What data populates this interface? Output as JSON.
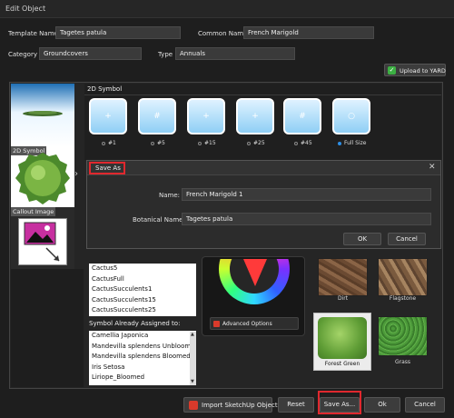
{
  "window": {
    "title": "Edit Object"
  },
  "form": {
    "template_name_label": "Template Name",
    "template_name_value": "Tagetes patula",
    "common_name_label": "Common Name",
    "common_name_value": "French Marigold",
    "category_label": "Category",
    "category_value": "Groundcovers",
    "type_label": "Type",
    "type_value": "Annuals"
  },
  "upload": {
    "label": "Upload to YARD",
    "checked": true
  },
  "left_panel": {
    "symbol_label": "2D Symbol",
    "callout_label": "Callout Image"
  },
  "symbol_panel": {
    "title": "2D Symbol",
    "options": [
      {
        "label": "#1",
        "selected": false
      },
      {
        "label": "#5",
        "selected": false
      },
      {
        "label": "#15",
        "selected": false
      },
      {
        "label": "#25",
        "selected": false
      },
      {
        "label": "#45",
        "selected": false
      },
      {
        "label": "Full Size",
        "selected": true
      }
    ]
  },
  "save_dialog": {
    "title": "Save As",
    "name_label": "Name:",
    "name_value": "French Marigold 1",
    "botanical_label": "Botanical Name:",
    "botanical_value": "Tagetes patula",
    "ok_label": "OK",
    "cancel_label": "Cancel"
  },
  "symbol_list": [
    "Cactus5",
    "CactusFull",
    "CactusSucculents1",
    "CactusSucculents15",
    "CactusSucculents25"
  ],
  "assigned": {
    "title": "Symbol Already Assigned to:",
    "items": [
      "Camellia Japonica",
      "Mandevilla splendens Unbloomed",
      "Mandevilla splendens Bloomed",
      "Iris Setosa",
      "Liriope_Bloomed"
    ]
  },
  "color_panel": {
    "advanced_label": "Advanced Options"
  },
  "textures": [
    {
      "label": "Dirt",
      "selected": false
    },
    {
      "label": "Flagstone",
      "selected": false
    },
    {
      "label": "Forest Green",
      "selected": true
    },
    {
      "label": "Grass",
      "selected": false
    }
  ],
  "footer": {
    "import_label": "Import SketchUp Object",
    "reset_label": "Reset",
    "save_as_label": "Save As...",
    "ok_label": "Ok",
    "cancel_label": "Cancel"
  },
  "colors": {
    "accent": "#2d8fe6",
    "highlight": "#e0282e",
    "brand_red": "#d93a2b"
  }
}
